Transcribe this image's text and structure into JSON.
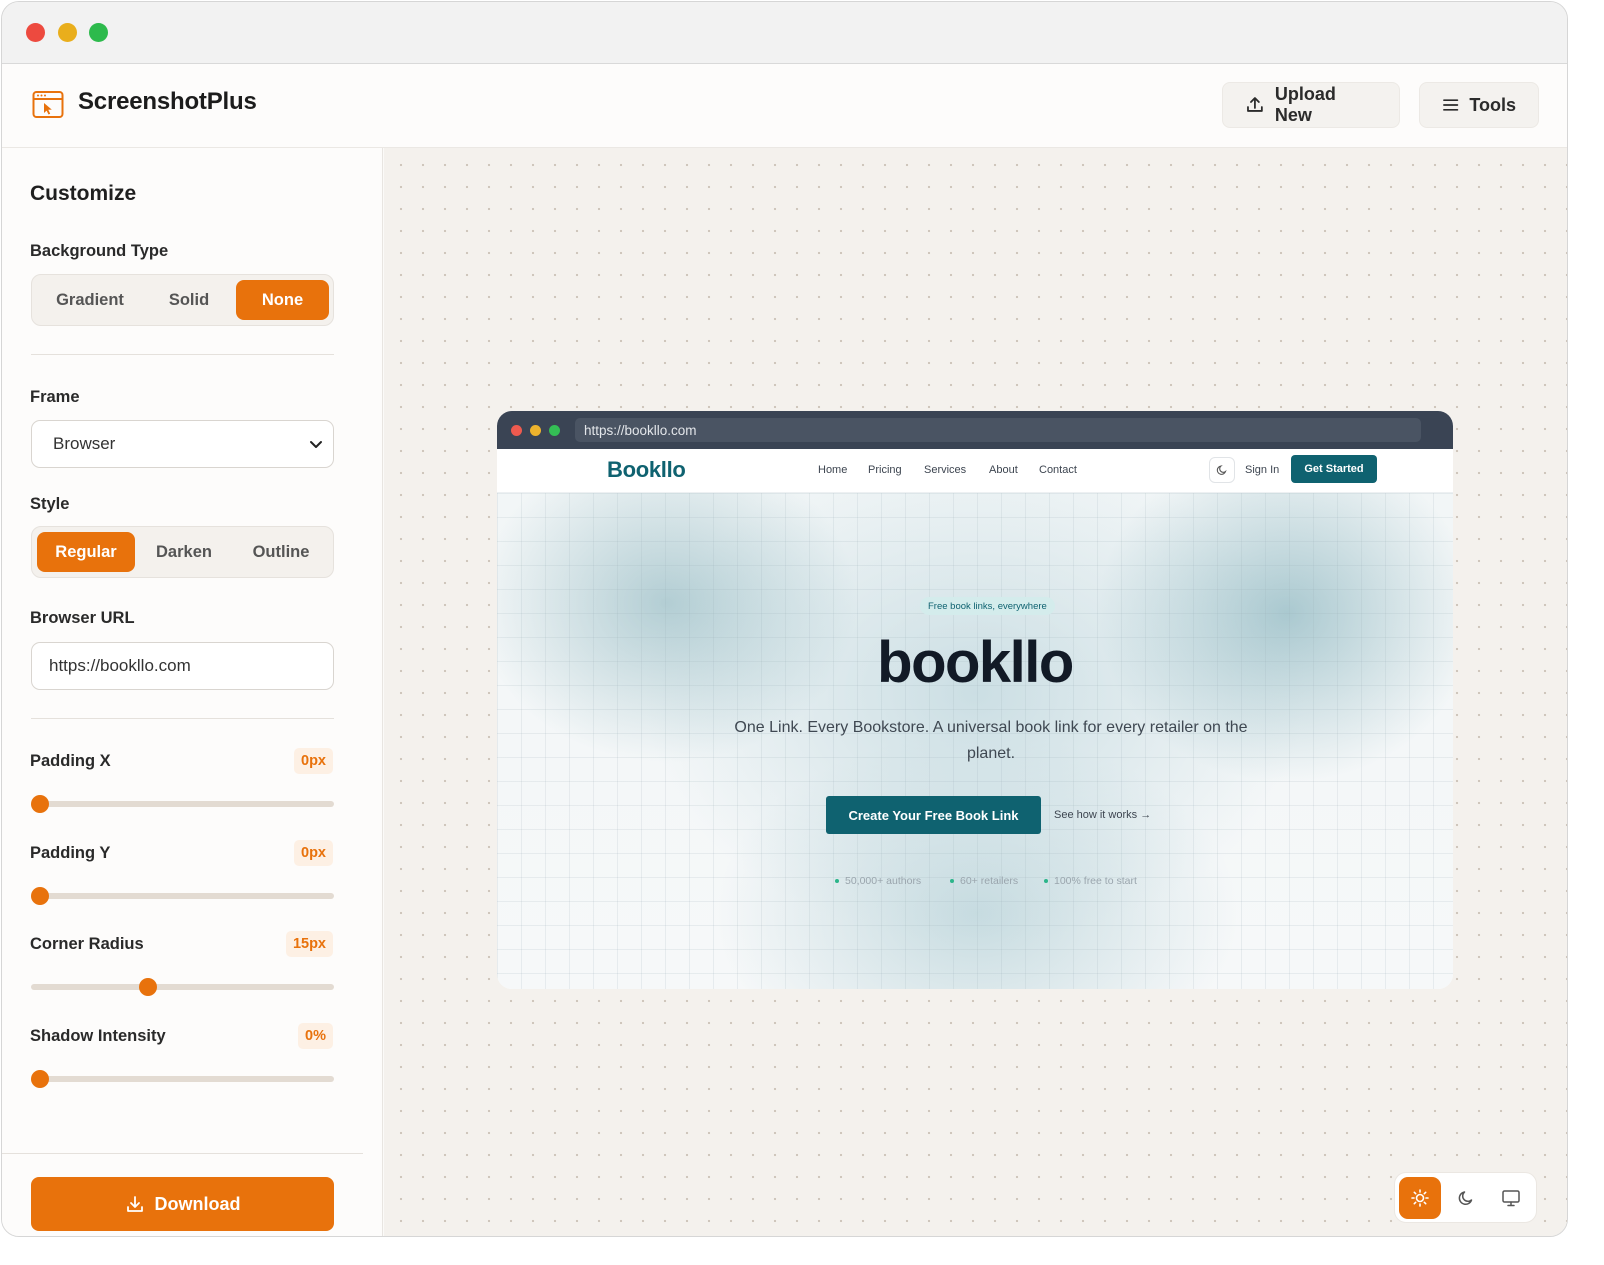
{
  "app": {
    "title": "ScreenshotPlus"
  },
  "toolbar": {
    "upload_label": "Upload New",
    "tools_label": "Tools"
  },
  "sidebar": {
    "heading": "Customize",
    "background_type": {
      "label": "Background Type",
      "options": [
        "Gradient",
        "Solid",
        "None"
      ],
      "selected": "None"
    },
    "frame": {
      "label": "Frame",
      "value": "Browser"
    },
    "style": {
      "label": "Style",
      "options": [
        "Regular",
        "Darken",
        "Outline"
      ],
      "selected": "Regular"
    },
    "browser_url": {
      "label": "Browser URL",
      "value": "https://bookllo.com"
    },
    "padding_x": {
      "label": "Padding X",
      "value_text": "0px",
      "fraction": 0.0
    },
    "padding_y": {
      "label": "Padding Y",
      "value_text": "0px",
      "fraction": 0.0
    },
    "corner_radius": {
      "label": "Corner Radius",
      "value_text": "15px",
      "fraction": 0.38
    },
    "shadow_intensity": {
      "label": "Shadow Intensity",
      "value_text": "0%",
      "fraction": 0.0
    },
    "download_label": "Download"
  },
  "preview": {
    "url": "https://bookllo.com",
    "brand": "Bookllo",
    "nav_links": [
      "Home",
      "Pricing",
      "Services",
      "About",
      "Contact"
    ],
    "sign_in": "Sign In",
    "get_started": "Get Started",
    "pill": "Free book links, everywhere",
    "title": "bookllo",
    "subtitle": "One Link. Every Bookstore. A universal book link for every retailer on the planet.",
    "cta": "Create Your Free Book Link",
    "secondary_link": "See how it works →",
    "stats": [
      "50,000+ authors",
      "60+ retailers",
      "100% free to start"
    ]
  },
  "theme_switcher": {
    "options": [
      "sun-icon",
      "moon-icon",
      "monitor-icon"
    ],
    "selected": "sun-icon"
  },
  "colors": {
    "accent": "#e8720c",
    "brand_teal": "#0f6270",
    "browser_chrome": "#3a4454"
  }
}
